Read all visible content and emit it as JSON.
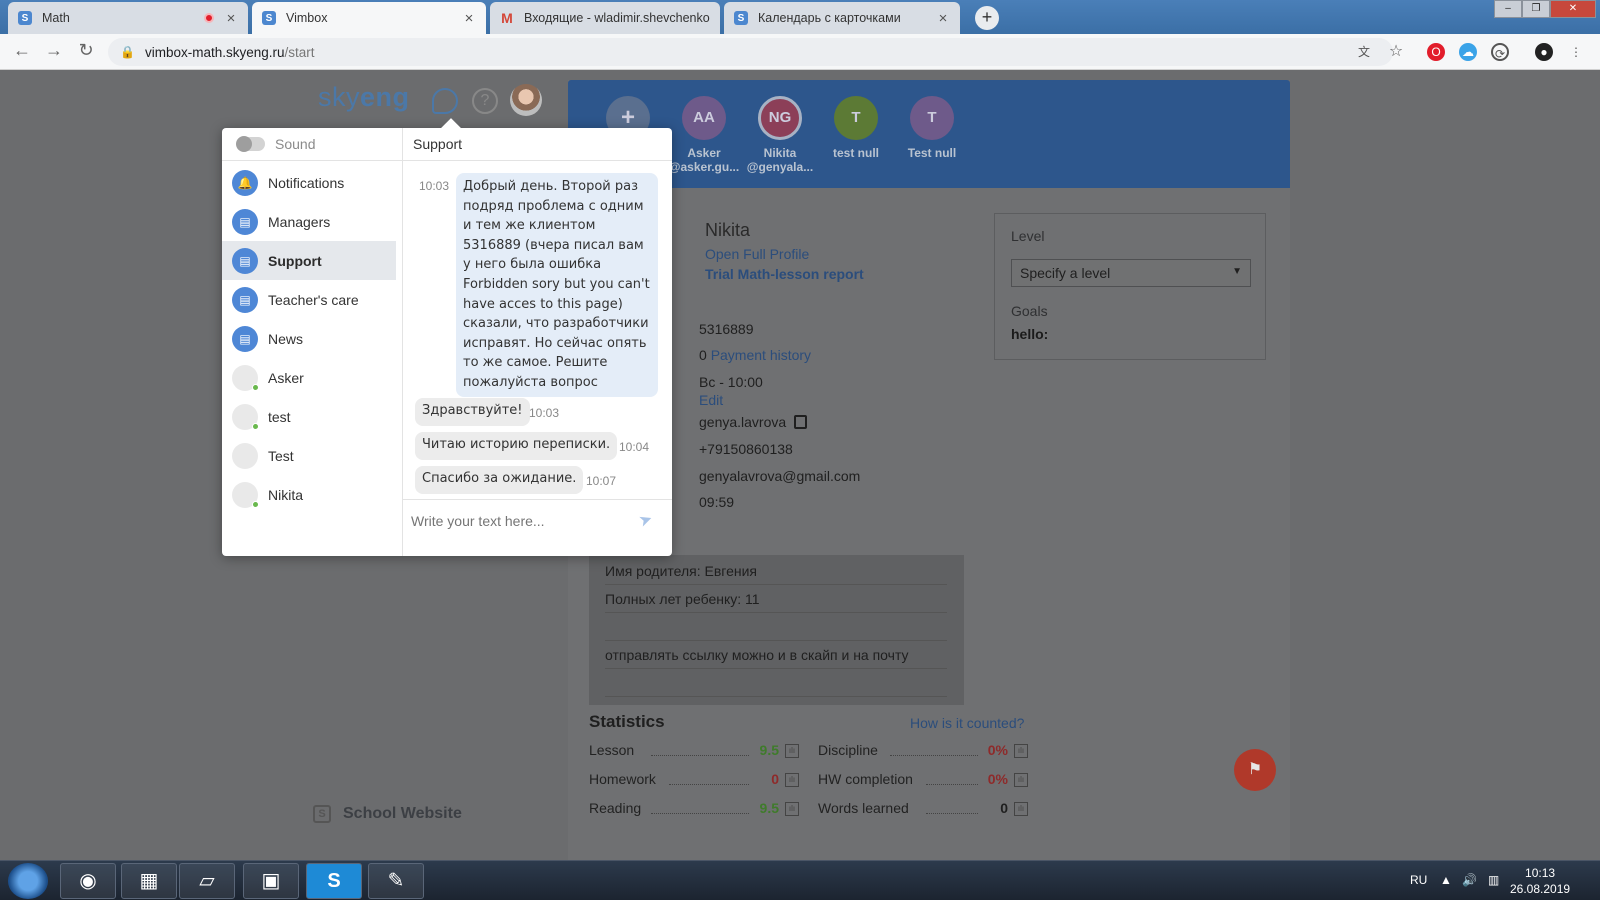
{
  "browser": {
    "tabs": [
      {
        "favicon": "S",
        "title": "Math",
        "recording": true
      },
      {
        "favicon": "S",
        "title": "Vimbox",
        "active": true
      },
      {
        "favicon": "gmail",
        "title": "Входящие - wladimir.shevchenko"
      },
      {
        "favicon": "S",
        "title": "Календарь с карточками"
      }
    ],
    "url_host": "vimbox-math.skyeng.ru",
    "url_path": "/start"
  },
  "header": {
    "logo_sky": "sky",
    "logo_eng": "eng"
  },
  "students": [
    {
      "initials": "+",
      "name": "",
      "color": "#5a6f8f"
    },
    {
      "initials": "AA",
      "name": "Asker",
      "name2": "@asker.gu...",
      "color": "#6e5a8a"
    },
    {
      "initials": "NG",
      "name": "Nikita",
      "name2": "@genyala...",
      "color": "#8c3f58",
      "selected": true
    },
    {
      "initials": "T",
      "name": "test null",
      "name2": "",
      "color": "#5c7a35"
    },
    {
      "initials": "T",
      "name": "Test null",
      "name2": "",
      "color": "#6e5a8a"
    }
  ],
  "profile": {
    "name": "Nikita",
    "open_full": "Open Full Profile",
    "report": "Trial Math-lesson report",
    "id": "5316889",
    "payments_count": "0",
    "payment_history": "Payment history",
    "schedule": "Вс - 10:00",
    "edit": "Edit",
    "login": "genya.lavrova",
    "phone": "+79150860138",
    "email": "genyalavrova@gmail.com",
    "local_time": "09:59"
  },
  "level": {
    "label": "Level",
    "placeholder": "Specify a level",
    "goals_label": "Goals",
    "goals_value": "hello:"
  },
  "notes": [
    "Имя родителя: Евгения",
    "Полных лет ребенку: 11",
    "",
    "отправлять ссылку можно и в скайп и на почту"
  ],
  "stats": {
    "title": "Statistics",
    "how": "How is it counted?",
    "items": [
      {
        "name": "Lesson",
        "value": "9.5",
        "color": "green"
      },
      {
        "name": "Homework",
        "value": "0",
        "color": "red"
      },
      {
        "name": "Reading",
        "value": "9.5",
        "color": "green"
      },
      {
        "name": "Discipline",
        "value": "0%",
        "color": "red"
      },
      {
        "name": "HW completion",
        "value": "0%",
        "color": "red"
      },
      {
        "name": "Words learned",
        "value": "0",
        "color": "dark"
      }
    ]
  },
  "school_website": "School Website",
  "chat": {
    "sound_label": "Sound",
    "channel_title": "Support",
    "channels": [
      {
        "label": "Notifications",
        "icon": "bell-icon"
      },
      {
        "label": "Managers",
        "icon": "channel-icon"
      },
      {
        "label": "Support",
        "icon": "channel-icon",
        "active": true
      },
      {
        "label": "Teacher's care",
        "icon": "channel-icon"
      },
      {
        "label": "News",
        "icon": "channel-icon"
      },
      {
        "label": "Asker",
        "icon": "person"
      },
      {
        "label": "test",
        "icon": "person"
      },
      {
        "label": "Test",
        "icon": "person"
      },
      {
        "label": "Nikita",
        "icon": "person"
      }
    ],
    "messages": [
      {
        "dir": "out",
        "time": "10:03",
        "text": "Добрый день. Второй раз подряд проблема с одним и тем же клиентом 5316889 (вчера писал вам у него была ошибка Forbidden sory but you can't have acces to this page) сказали, что разработчики исправят. Но сейчас опять то же самое. Решите пожалуйста вопрос"
      },
      {
        "dir": "in",
        "time": "10:03",
        "text": "Здравствуйте!"
      },
      {
        "dir": "in",
        "time": "10:04",
        "text": "Читаю историю переписки."
      },
      {
        "dir": "in",
        "time": "10:07",
        "text": "Спасибо за ожидание."
      }
    ],
    "input_placeholder": "Write your text here..."
  },
  "taskbar": {
    "lang": "RU",
    "time": "10:13",
    "date": "26.08.2019"
  }
}
